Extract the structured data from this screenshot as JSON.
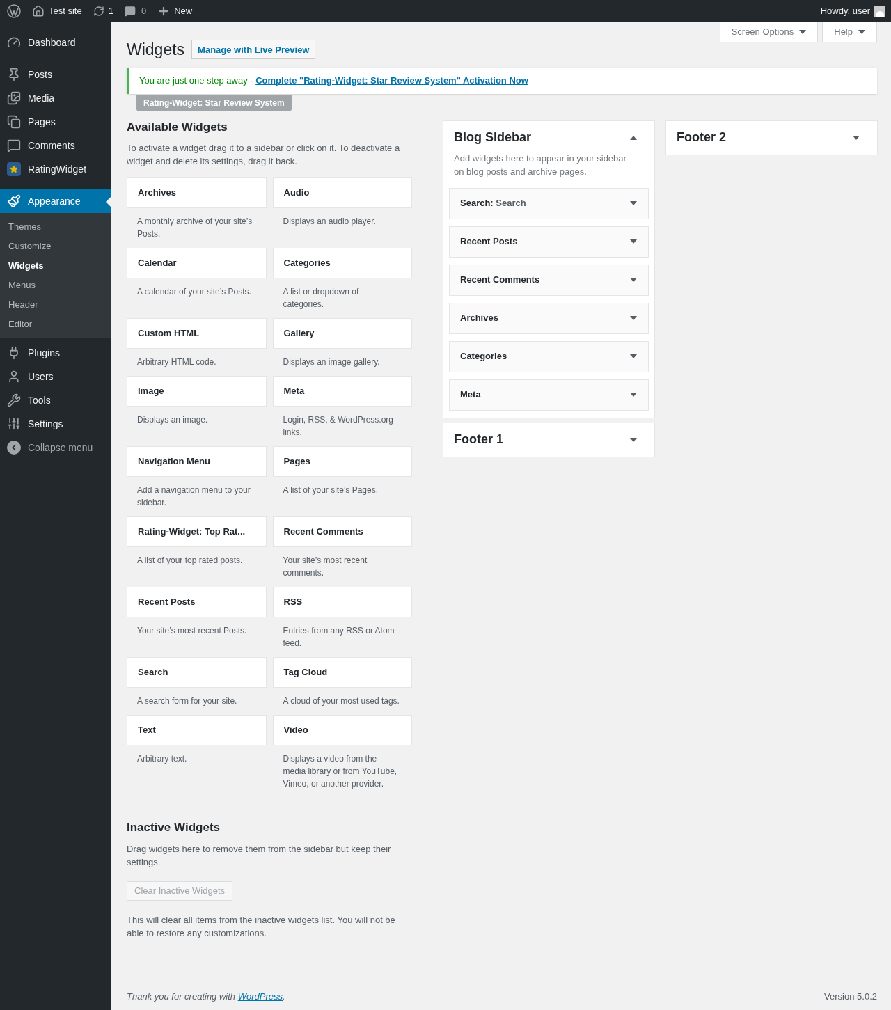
{
  "admin_bar": {
    "site": "Test site",
    "updates": "1",
    "comments": "0",
    "new": "New",
    "howdy": "Howdy, user"
  },
  "menu": [
    {
      "label": "Dashboard",
      "selected": false
    },
    {
      "label": "Posts",
      "selected": false
    },
    {
      "label": "Media",
      "selected": false
    },
    {
      "label": "Pages",
      "selected": false
    },
    {
      "label": "Comments",
      "selected": false
    },
    {
      "label": "RatingWidget",
      "selected": false
    },
    {
      "label": "Appearance",
      "selected": true,
      "children": [
        {
          "label": "Themes",
          "selected": false
        },
        {
          "label": "Customize",
          "selected": false
        },
        {
          "label": "Widgets",
          "selected": true
        },
        {
          "label": "Menus",
          "selected": false
        },
        {
          "label": "Header",
          "selected": false
        },
        {
          "label": "Editor",
          "selected": false
        }
      ]
    },
    {
      "label": "Plugins",
      "selected": false
    },
    {
      "label": "Users",
      "selected": false
    },
    {
      "label": "Tools",
      "selected": false
    },
    {
      "label": "Settings",
      "selected": false
    },
    {
      "label": "Collapse menu",
      "selected": false
    }
  ],
  "screen_options": "Screen Options",
  "help": "Help",
  "page_title": "Widgets",
  "live_preview": "Manage with Live Preview",
  "notice": {
    "text": "You are just one step away - ",
    "link": "Complete \"Rating-Widget: Star Review System\" Activation Now"
  },
  "plugin_tag": "Rating-Widget: Star Review System",
  "available": {
    "title": "Available Widgets",
    "description": "To activate a widget drag it to a sidebar or click on it. To deactivate a widget and delete its settings, drag it back.",
    "widgets": [
      {
        "title": "Archives",
        "description": "A monthly archive of your site’s Posts."
      },
      {
        "title": "Audio",
        "description": "Displays an audio player."
      },
      {
        "title": "Calendar",
        "description": "A calendar of your site’s Posts."
      },
      {
        "title": "Categories",
        "description": "A list or dropdown of categories."
      },
      {
        "title": "Custom HTML",
        "description": "Arbitrary HTML code."
      },
      {
        "title": "Gallery",
        "description": "Displays an image gallery."
      },
      {
        "title": "Image",
        "description": "Displays an image."
      },
      {
        "title": "Meta",
        "description": "Login, RSS, & WordPress.org links."
      },
      {
        "title": "Navigation Menu",
        "description": "Add a navigation menu to your sidebar."
      },
      {
        "title": "Pages",
        "description": "A list of your site’s Pages."
      },
      {
        "title": "Rating-Widget: Top Rat...",
        "description": "A list of your top rated posts."
      },
      {
        "title": "Recent Comments",
        "description": "Your site’s most recent comments."
      },
      {
        "title": "Recent Posts",
        "description": "Your site’s most recent Posts."
      },
      {
        "title": "RSS",
        "description": "Entries from any RSS or Atom feed."
      },
      {
        "title": "Search",
        "description": "A search form for your site."
      },
      {
        "title": "Tag Cloud",
        "description": "A cloud of your most used tags."
      },
      {
        "title": "Text",
        "description": "Arbitrary text."
      },
      {
        "title": "Video",
        "description": "Displays a video from the media library or from YouTube, Vimeo, or another provider."
      }
    ]
  },
  "inactive": {
    "title": "Inactive Widgets",
    "description": "Drag widgets here to remove them from the sidebar but keep their settings.",
    "button": "Clear Inactive Widgets",
    "note": "This will clear all items from the inactive widgets list. You will not be able to restore any customizations."
  },
  "sidebars": [
    {
      "title": "Blog Sidebar",
      "expanded": true,
      "description": "Add widgets here to appear in your sidebar on blog posts and archive pages.",
      "widgets": [
        {
          "title": "Search:",
          "subtitle": "Search",
          "expanded": false
        },
        {
          "title": "Recent Posts",
          "expanded": false
        },
        {
          "title": "Recent Comments",
          "expanded": false
        },
        {
          "title": "Archives",
          "expanded": false
        },
        {
          "title": "Categories",
          "expanded": false
        },
        {
          "title": "Meta",
          "expanded": false
        }
      ]
    },
    {
      "title": "Footer 1",
      "expanded": false
    },
    {
      "title": "Footer 2",
      "expanded": false
    }
  ],
  "footer": {
    "text": "Thank you for creating with ",
    "link": "WordPress",
    "after": ".",
    "version": "Version 5.0.2"
  }
}
